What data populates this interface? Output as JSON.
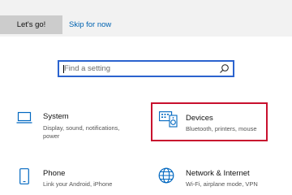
{
  "header": {
    "primary_button": "Let's go!",
    "secondary_link": "Skip for now"
  },
  "search": {
    "placeholder": "Find a setting",
    "icon": "search-icon"
  },
  "categories": [
    {
      "title": "System",
      "description_lines": [
        "Display, sound, notifications,",
        "power"
      ],
      "icon": "laptop-icon",
      "highlighted": false
    },
    {
      "title": "Devices",
      "description_lines": [
        "Bluetooth, printers, mouse"
      ],
      "icon": "keyboard-speaker-icon",
      "highlighted": true
    },
    {
      "title": "Phone",
      "description_lines": [
        "Link your Android, iPhone"
      ],
      "icon": "phone-icon",
      "highlighted": false
    },
    {
      "title": "Network & Internet",
      "description_lines": [
        "Wi-Fi, airplane mode, VPN"
      ],
      "icon": "globe-icon",
      "highlighted": false
    }
  ],
  "colors": {
    "accent": "#0063b1",
    "icon_blue": "#0067c0",
    "highlight_border": "#c8102e",
    "search_border": "#2b63cf",
    "header_bg": "#f2f2f2",
    "button_bg": "#cccccc"
  }
}
